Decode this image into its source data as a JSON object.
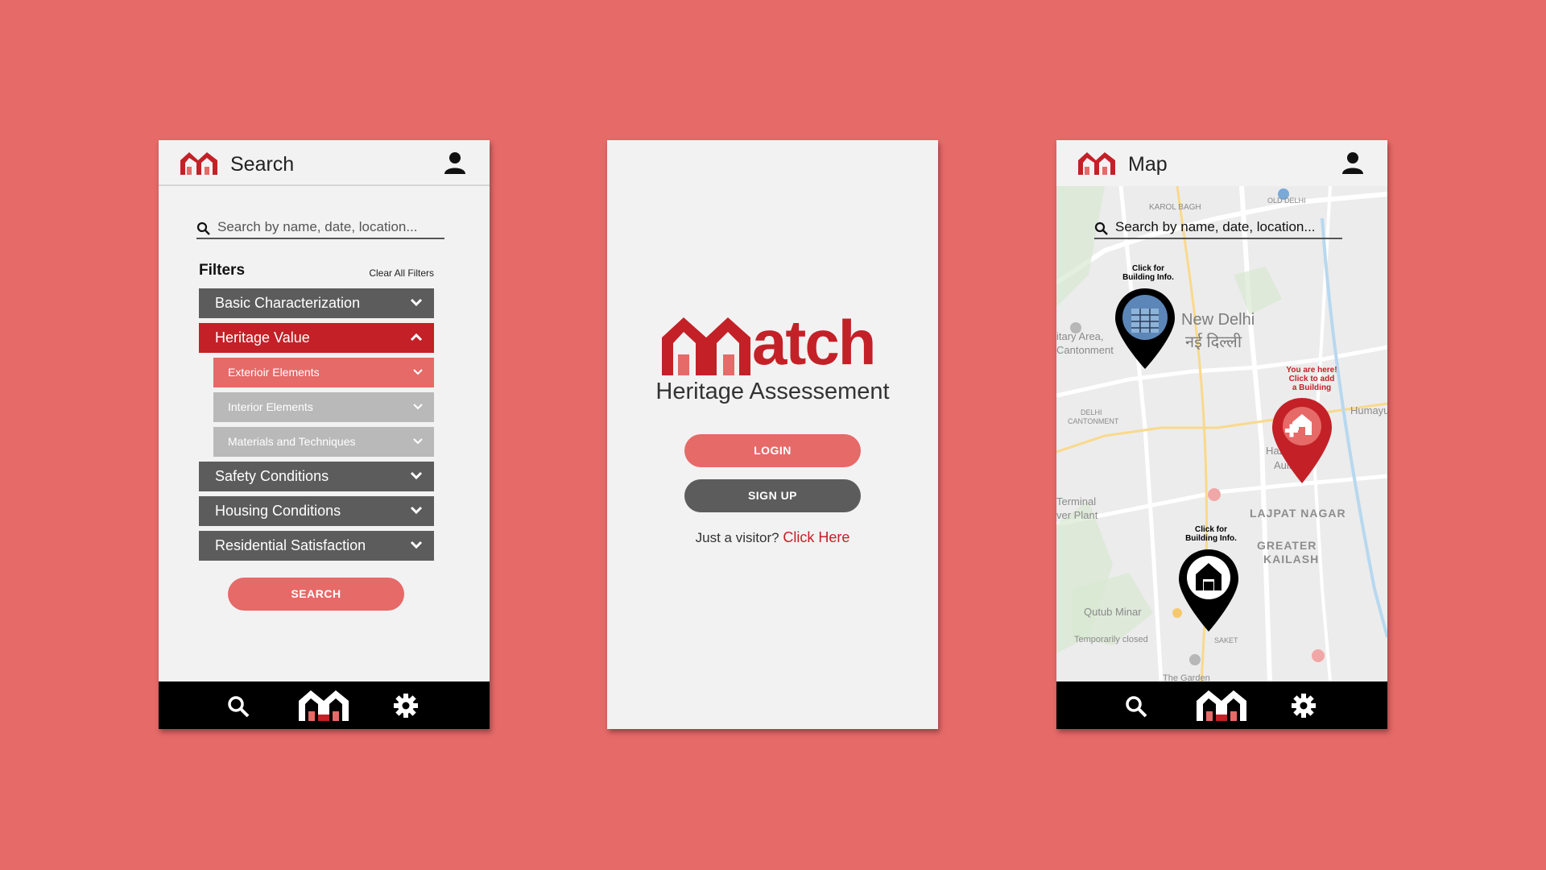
{
  "colors": {
    "background": "#e56a68",
    "brand_red": "#c32127",
    "dark_grey": "#5c5c5c",
    "light_grey": "#b9b9b9",
    "nav_black": "#000000"
  },
  "search_screen": {
    "header": {
      "title": "Search",
      "logo_icon": "match-house-logo",
      "profile_icon": "user-icon"
    },
    "search": {
      "placeholder": "Search by name, date, location..."
    },
    "filters": {
      "heading": "Filters",
      "clear_label": "Clear All Filters",
      "items": [
        {
          "label": "Basic Characterization",
          "state": "collapsed"
        },
        {
          "label": "Heritage Value",
          "state": "expanded"
        },
        {
          "label": "Safety Conditions",
          "state": "collapsed"
        },
        {
          "label": "Housing Conditions",
          "state": "collapsed"
        },
        {
          "label": "Residential Satisfaction",
          "state": "collapsed"
        }
      ],
      "sub_items": [
        {
          "label": "Exterioir Elements"
        },
        {
          "label": "Interior Elements"
        },
        {
          "label": "Materials and Techniques"
        }
      ]
    },
    "search_button": "SEARCH"
  },
  "login_screen": {
    "logo_text": "atch",
    "subtitle": "Heritage Assessement",
    "login_button": "LOGIN",
    "signup_button": "SIGN UP",
    "visitor_text": "Just a visitor?",
    "visitor_link": "Click Here"
  },
  "map_screen": {
    "header": {
      "title": "Map"
    },
    "search": {
      "placeholder": "Search by name, date, location..."
    },
    "pins": {
      "building_1_caption_line1": "Click for",
      "building_1_caption_line2": "Building Info.",
      "building_2_caption_line1": "Click for",
      "building_2_caption_line2": "Building Info.",
      "add_line1": "You are here!",
      "add_line2": "Click to add",
      "add_line3": "a Building"
    },
    "map_labels": {
      "karol_bagh": "KAROL BAGH",
      "new_delhi": "New Delhi",
      "new_delhi_hindi": "नई दिल्ली",
      "military_area": "itary Area,",
      "cantonment": "Cantonment",
      "delhi_cantonment": "DELHI",
      "cantonment_caps": "CANTONMENT",
      "hazrat": "Hazrat Ni",
      "terminal": "Terminal",
      "power_plant": "ver Plant",
      "lajpat_nagar": "LAJPAT NAGAR",
      "greater": "GREATER",
      "kailash": "KAILASH",
      "qutub": "Qutub Minar",
      "temp_closed": "Temporarily closed",
      "saket": "SAKET",
      "humayun": "Humayu",
      "old_delhi": "OLD DELHI",
      "auli": "Aulia",
      "the_garden": "The Garden"
    },
    "nav": [
      "search-icon",
      "home-icon",
      "gear-icon"
    ]
  }
}
